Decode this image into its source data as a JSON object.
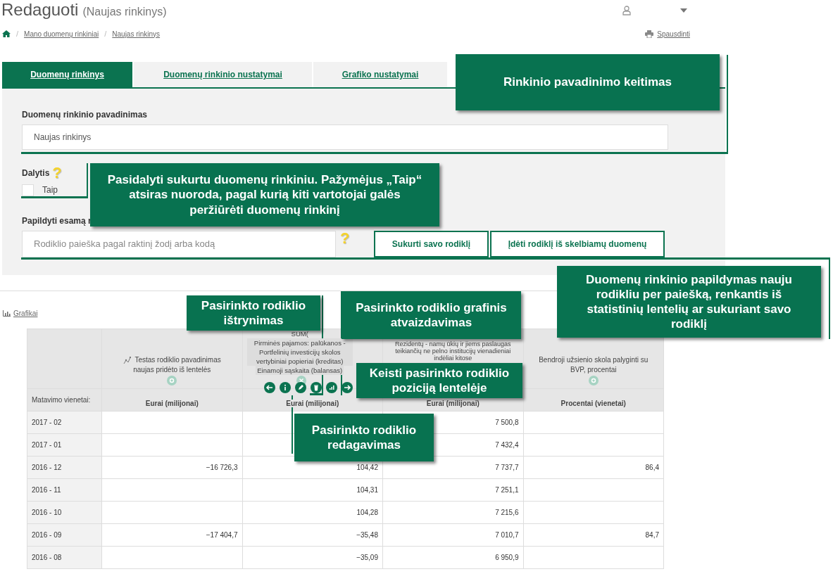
{
  "page": {
    "title": "Redaguoti",
    "subtitle": "(Naujas rinkinys)"
  },
  "breadcrumbs": [
    {
      "separator": "/",
      "label": "Mano duomenų rinkiniai"
    },
    {
      "separator": "/",
      "label": "Naujas rinkinys"
    }
  ],
  "print_link": "Spausdinti",
  "tabs": [
    {
      "label": "Duomenų rinkinys",
      "selected": true
    },
    {
      "label": "Duomenų rinkinio nustatymai",
      "selected": false
    },
    {
      "label": "Grafiko nustatymai",
      "selected": false
    }
  ],
  "name_field": {
    "label": "Duomenų rinkinio pavadinimas",
    "value": "Naujas rinkinys"
  },
  "share": {
    "label": "Dalytis",
    "help": "?",
    "option": "Taip",
    "checked": false
  },
  "add": {
    "label": "Papildyti esamą r",
    "placeholder": "Rodiklio paieška pagal raktinį žodį arba kodą",
    "help": "?",
    "buttons": [
      "Sukurti savo rodiklį",
      "Įdėti rodiklį iš skelbiamų duomenų"
    ]
  },
  "charts_link": "Grafikai",
  "table": {
    "units_label": "Matavimo vienetai:",
    "columns": [
      {
        "kind": "plain",
        "title": "Testas rodiklio pavadinimas naujas pridėto iš lentelės",
        "unit": "Eurai (milijonai)",
        "settings_icon": true
      },
      {
        "kind": "sum",
        "prefix": "SUM(",
        "tags": [
          "Pirminės pajamos: palūkanos - Portfelinių investicijų skolos vertybiniai popieriai (kreditas)",
          "Einamoji sąskaita (balansas)"
        ],
        "unit": "Eurai (milijonai)"
      },
      {
        "kind": "plain",
        "title": "Rezidentų - namų ūkių ir jiems paslaugas teikiančių ne pelno institucijų vienadieniai indėliai kitose",
        "unit": "Eurai (milijonai)",
        "settings_icon": false
      },
      {
        "kind": "plain",
        "title": "Bendroji užsienio skola palyginti su BVP, procentai",
        "unit": "Procentai (vienetai)",
        "settings_icon": true
      }
    ],
    "rows": [
      {
        "period": "2017 - 02",
        "cells": [
          null,
          null,
          "7 500,8",
          null
        ]
      },
      {
        "period": "2017 - 01",
        "cells": [
          null,
          null,
          "7 432,4",
          null
        ]
      },
      {
        "period": "2016 - 12",
        "cells": [
          "−16 726,3",
          "104,42",
          "7 737,7",
          "86,4"
        ]
      },
      {
        "period": "2016 - 11",
        "cells": [
          null,
          "104,31",
          "7 251,1",
          null
        ]
      },
      {
        "period": "2016 - 10",
        "cells": [
          null,
          "104,28",
          "7 215,6",
          null
        ]
      },
      {
        "period": "2016 - 09",
        "cells": [
          "−17 404,7",
          "−35,48",
          "7 010,7",
          "84,7"
        ]
      },
      {
        "period": "2016 - 08",
        "cells": [
          null,
          "−35,09",
          "6 950,9",
          null
        ]
      }
    ]
  },
  "callouts": [
    "Rinkinio pavadinimo keitimas",
    "Pasidalyti sukurtu duomenų rinkiniu. Pažymėjus „Taip“ atsiras nuoroda, pagal kurią kiti vartotojai galės peržiūrėti duomenų rinkinį",
    "Pasirinkto rodiklio ištrynimas",
    "Pasirinkto rodiklio grafinis atvaizdavimas",
    "Duomenų rinkinio papildymas nauju rodikliu per paiešką, renkantis iš statistinių lentelių ar sukuriant savo rodiklį",
    "Keisti pasirinkto rodiklio poziciją lentelėje",
    "Pasirinkto rodiklio redagavimas"
  ]
}
